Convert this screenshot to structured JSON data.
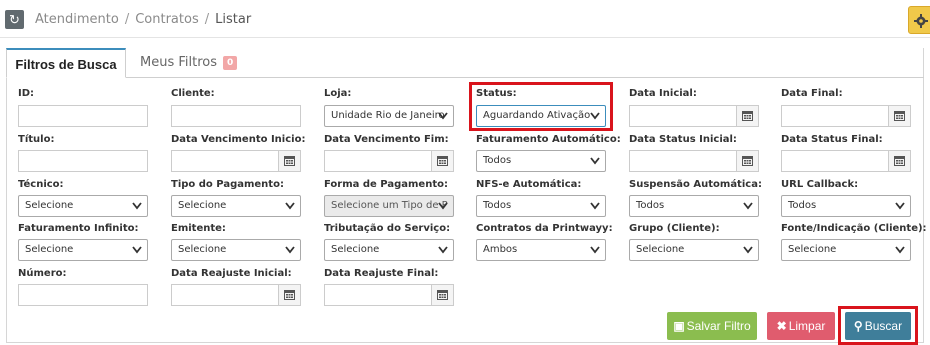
{
  "breadcrumb": {
    "items": [
      "Atendimento",
      "Contratos",
      "Listar"
    ]
  },
  "tabs": {
    "search_label": "Filtros de Busca",
    "my_filters_label": "Meus Filtros",
    "my_filters_count": "0"
  },
  "fields": {
    "id": {
      "label": "ID:"
    },
    "cliente": {
      "label": "Cliente:"
    },
    "loja": {
      "label": "Loja:",
      "value": "Unidade Rio de Janeiro"
    },
    "status": {
      "label": "Status:",
      "value": "Aguardando Ativação"
    },
    "data_inicial": {
      "label": "Data Inicial:"
    },
    "data_final": {
      "label": "Data Final:"
    },
    "titulo": {
      "label": "Título:"
    },
    "data_venc_inicio": {
      "label": "Data Vencimento Inicio:"
    },
    "data_venc_fim": {
      "label": "Data Vencimento Fim:"
    },
    "faturamento_auto": {
      "label": "Faturamento Automático:",
      "value": "Todos"
    },
    "data_status_inicial": {
      "label": "Data Status Inicial:"
    },
    "data_status_final": {
      "label": "Data Status Final:"
    },
    "tecnico": {
      "label": "Técnico:",
      "value": "Selecione"
    },
    "tipo_pagamento": {
      "label": "Tipo do Pagamento:",
      "value": "Selecione"
    },
    "forma_pagamento": {
      "label": "Forma de Pagamento:",
      "value": "Selecione um Tipo de P"
    },
    "nfse_auto": {
      "label": "NFS-e Automática:",
      "value": "Todos"
    },
    "suspensao_auto": {
      "label": "Suspensão Automática:",
      "value": "Todos"
    },
    "url_callback": {
      "label": "URL Callback:",
      "value": "Todos"
    },
    "faturamento_infinito": {
      "label": "Faturamento Infinito:",
      "value": "Selecione"
    },
    "emitente": {
      "label": "Emitente:",
      "value": "Selecione"
    },
    "tributacao": {
      "label": "Tributação do Serviço:",
      "value": "Selecione"
    },
    "contratos_printwayy": {
      "label": "Contratos da Printwayy:",
      "value": "Ambos"
    },
    "grupo_cliente": {
      "label": "Grupo (Cliente):",
      "value": "Selecione"
    },
    "fonte_indicacao": {
      "label": "Fonte/Indicação (Cliente):",
      "value": "Selecione"
    },
    "numero": {
      "label": "Número:"
    },
    "data_reajuste_inicial": {
      "label": "Data Reajuste Inicial:"
    },
    "data_reajuste_final": {
      "label": "Data Reajuste Final:"
    }
  },
  "buttons": {
    "salvar": "Salvar Filtro",
    "limpar": "Limpar",
    "buscar": "Buscar"
  },
  "colors": {
    "accent": "#3c8dbc",
    "highlight": "#d9141c",
    "salvar": "#8bbd4f",
    "limpar": "#e05c6e",
    "buscar": "#3f7e9a"
  },
  "icons": [
    "refresh-icon",
    "gear-icon",
    "calendar-icon",
    "chevron-down-icon",
    "save-icon",
    "close-icon",
    "search-icon"
  ]
}
